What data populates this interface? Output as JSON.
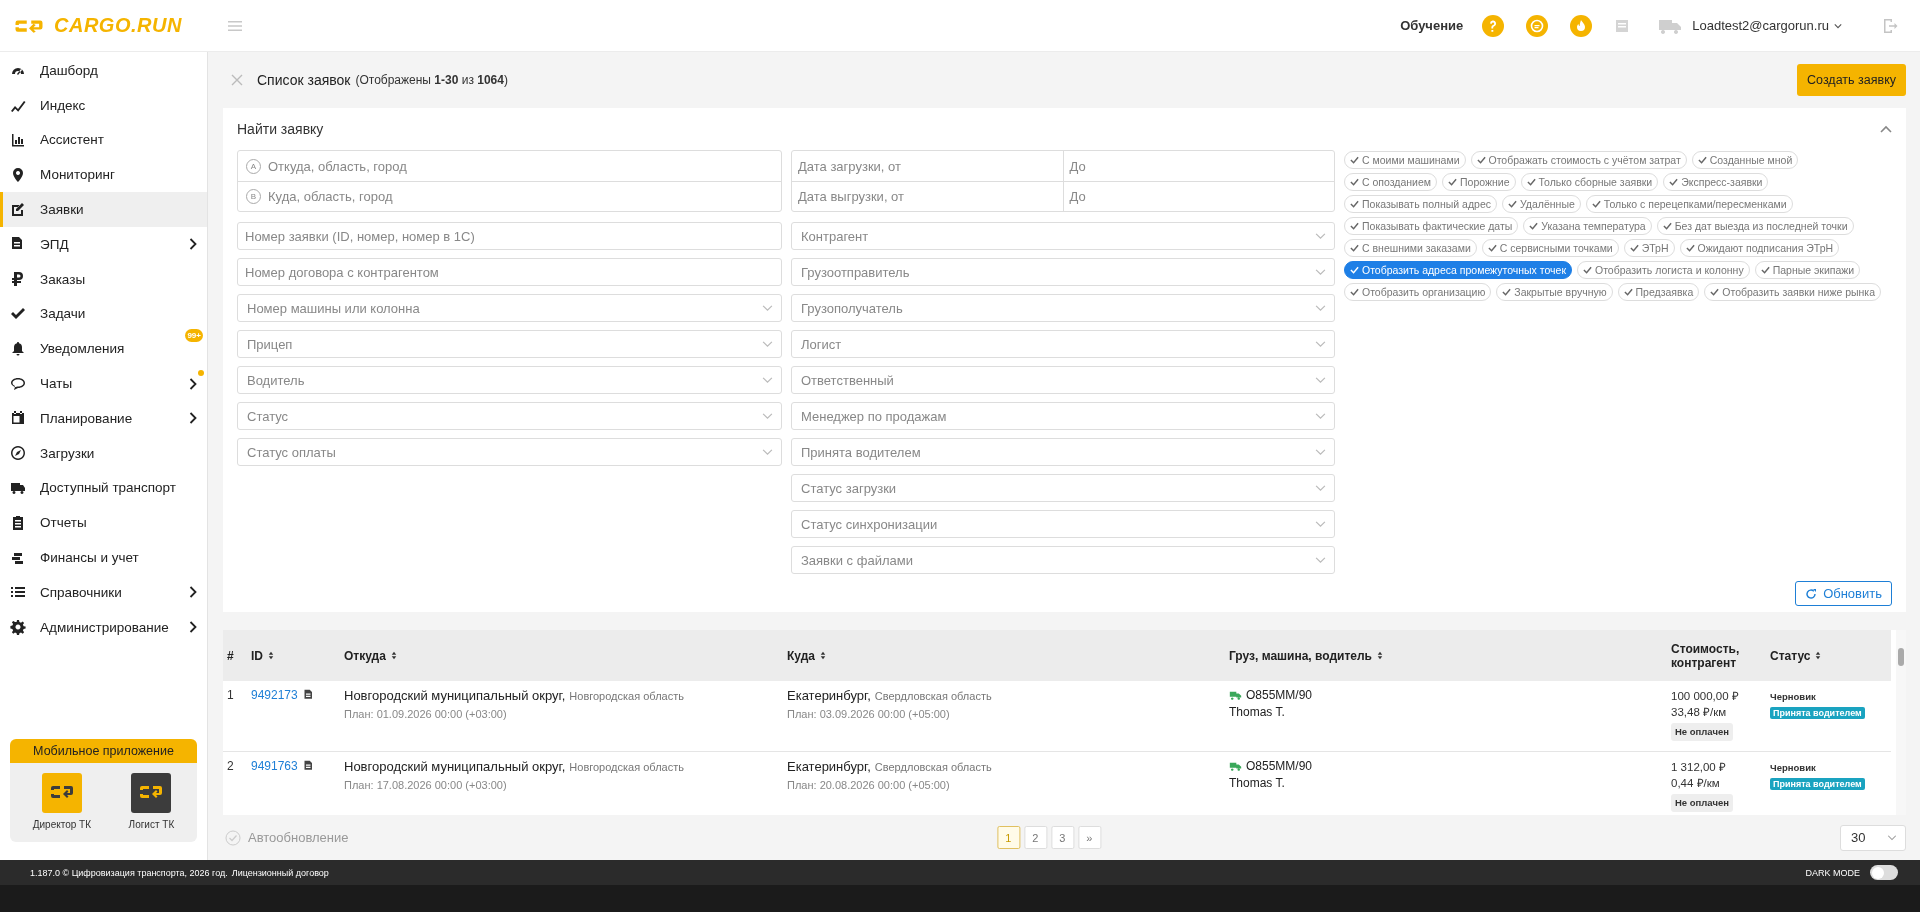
{
  "header": {
    "logo": "CARGO.RUN",
    "help_label": "Обучение",
    "user": "Loadtest2@cargorun.ru"
  },
  "sidebar": {
    "items": [
      {
        "label": "Дашборд",
        "selected": false,
        "expandable": false,
        "dot": false
      },
      {
        "label": "Индекс",
        "selected": false,
        "expandable": false,
        "dot": false
      },
      {
        "label": "Ассистент",
        "selected": false,
        "expandable": false,
        "dot": false
      },
      {
        "label": "Мониторинг",
        "selected": false,
        "expandable": false,
        "dot": false
      },
      {
        "label": "Заявки",
        "selected": true,
        "expandable": false,
        "dot": false
      },
      {
        "label": "ЭПД",
        "selected": false,
        "expandable": true,
        "dot": false
      },
      {
        "label": "Заказы",
        "selected": false,
        "expandable": false,
        "dot": false
      },
      {
        "label": "Задачи",
        "selected": false,
        "expandable": false,
        "dot": false
      },
      {
        "label": "Уведомления",
        "selected": false,
        "expandable": false,
        "dot": false,
        "badge": "99+"
      },
      {
        "label": "Чаты",
        "selected": false,
        "expandable": true,
        "dot": true
      },
      {
        "label": "Планирование",
        "selected": false,
        "expandable": true,
        "dot": false
      },
      {
        "label": "Загрузки",
        "selected": false,
        "expandable": false,
        "dot": false
      },
      {
        "label": "Доступный транспорт",
        "selected": false,
        "expandable": false,
        "dot": false
      },
      {
        "label": "Отчеты",
        "selected": false,
        "expandable": false,
        "dot": false
      },
      {
        "label": "Финансы и учет",
        "selected": false,
        "expandable": false,
        "dot": false
      },
      {
        "label": "Справочники",
        "selected": false,
        "expandable": true,
        "dot": false
      },
      {
        "label": "Администрирование",
        "selected": false,
        "expandable": true,
        "dot": false
      }
    ],
    "mobile_app": {
      "title": "Мобильное приложение",
      "apps": [
        {
          "label": "Директор ТК",
          "color": "#f5b400"
        },
        {
          "label": "Логист ТК",
          "color": "#3c3c3c"
        }
      ]
    }
  },
  "page": {
    "title": "Список заявок",
    "subtitle": "(Отображены **1-30** из **1064**)",
    "create_button": "Создать заявку"
  },
  "filters": {
    "title": "Найти заявку",
    "expanded": true,
    "route": [
      {
        "letter": "A",
        "placeholder": "Откуда, область, город"
      },
      {
        "letter": "B",
        "placeholder": "Куда, область, город"
      }
    ],
    "left": [
      {
        "placeholder": "Номер заявки (ID, номер, номер в 1С)",
        "kind": "text"
      },
      {
        "placeholder": "Номер договора с контрагентом",
        "kind": "text"
      },
      {
        "placeholder": "Номер машины или колонна",
        "kind": "select"
      },
      {
        "placeholder": "Прицеп",
        "kind": "select"
      },
      {
        "placeholder": "Водитель",
        "kind": "select"
      },
      {
        "placeholder": "Статус",
        "kind": "select"
      },
      {
        "placeholder": "Статус оплаты",
        "kind": "select"
      }
    ],
    "dates": [
      {
        "from": "Дата загрузки, от",
        "to": "До"
      },
      {
        "from": "Дата выгрузки, от",
        "to": "До"
      }
    ],
    "right": [
      {
        "placeholder": "Контрагент",
        "kind": "select"
      },
      {
        "placeholder": "Грузоотправитель",
        "kind": "select"
      },
      {
        "placeholder": "Грузополучатель",
        "kind": "select"
      },
      {
        "placeholder": "Логист",
        "kind": "select"
      },
      {
        "placeholder": "Ответственный",
        "kind": "select"
      },
      {
        "placeholder": "Менеджер по продажам",
        "kind": "select"
      },
      {
        "placeholder": "Принята водителем",
        "kind": "select"
      },
      {
        "placeholder": "Статус загрузки",
        "kind": "select"
      },
      {
        "placeholder": "Статус синхронизации",
        "kind": "select"
      },
      {
        "placeholder": "Заявки с файлами",
        "kind": "select"
      }
    ],
    "tags": [
      {
        "label": "С моими машинами",
        "selected": false
      },
      {
        "label": "Отображать стоимость с учётом затрат",
        "selected": false
      },
      {
        "label": "Созданные мной",
        "selected": false
      },
      {
        "label": "С опозданием",
        "selected": false
      },
      {
        "label": "Порожние",
        "selected": false
      },
      {
        "label": "Только сборные заявки",
        "selected": false
      },
      {
        "label": "Экспресс-заявки",
        "selected": false
      },
      {
        "label": "Показывать полный адрес",
        "selected": false
      },
      {
        "label": "Удалённые",
        "selected": false
      },
      {
        "label": "Только с перецепками/пересменками",
        "selected": false
      },
      {
        "label": "Показывать фактические даты",
        "selected": false
      },
      {
        "label": "Указана температура",
        "selected": false
      },
      {
        "label": "Без дат выезда из последней точки",
        "selected": false
      },
      {
        "label": "С внешними заказами",
        "selected": false
      },
      {
        "label": "С сервисными точками",
        "selected": false
      },
      {
        "label": "ЭТрН",
        "selected": false
      },
      {
        "label": "Ожидают подписания ЭТрН",
        "selected": false
      },
      {
        "label": "Отобразить адреса промежуточных точек",
        "selected": true
      },
      {
        "label": "Отобразить логиста и колонну",
        "selected": false
      },
      {
        "label": "Парные экипажи",
        "selected": false
      },
      {
        "label": "Отобразить организацию",
        "selected": false
      },
      {
        "label": "Закрытые вручную",
        "selected": false
      },
      {
        "label": "Предзаявка",
        "selected": false
      },
      {
        "label": "Отобразить заявки ниже рынка",
        "selected": false
      }
    ],
    "refresh_button": "Обновить"
  },
  "table": {
    "columns": [
      {
        "label": "#",
        "sortable": false
      },
      {
        "label": "ID",
        "sortable": true
      },
      {
        "label": "Откуда",
        "sortable": true
      },
      {
        "label": "Куда",
        "sortable": true
      },
      {
        "label": "Груз, машина, водитель",
        "sortable": true
      },
      {
        "label": "Стоимость, контрагент",
        "sortable": false
      },
      {
        "label": "Статус",
        "sortable": true
      }
    ],
    "rows": [
      {
        "num": "1",
        "id": "9492173",
        "from_city": "Новгородский муниципальный округ,",
        "from_region": "Новгородская область",
        "from_plan": "План: 01.09.2026 00:00 (+03:00)",
        "to_city": "Екатеринбург,",
        "to_region": "Свердловская область",
        "to_plan": "План: 03.09.2026 00:00 (+05:00)",
        "vehicle": "О855ММ/90",
        "driver": "Thomas T.",
        "price": "100 000,00 ₽",
        "rate": "33,48 ₽/км",
        "payment": "Не оплачен",
        "status": "Черновик",
        "accepted": "Принята водителем"
      },
      {
        "num": "2",
        "id": "9491763",
        "from_city": "Новгородский муниципальный округ,",
        "from_region": "Новгородская область",
        "from_plan": "План: 17.08.2026 00:00 (+03:00)",
        "to_city": "Екатеринбург,",
        "to_region": "Свердловская область",
        "to_plan": "План: 20.08.2026 00:00 (+05:00)",
        "vehicle": "О855ММ/90",
        "driver": "Thomas T.",
        "price": "1 312,00 ₽",
        "rate": "0,44 ₽/км",
        "payment": "Не оплачен",
        "status": "Черновик",
        "accepted": "Принята водителем"
      }
    ]
  },
  "bottom": {
    "autoupdate": {
      "label": "Автообновление",
      "checked": false
    },
    "pagination": {
      "pages": [
        {
          "label": "1",
          "selected": true
        },
        {
          "label": "2",
          "selected": false
        },
        {
          "label": "3",
          "selected": false
        }
      ],
      "next": "»"
    },
    "page_size": "30"
  },
  "footer": {
    "version": "1.187.0 © Цифровизация транспорта, 2026 год.",
    "license_link": "Лицензионный договор",
    "dark_mode": {
      "label": "DARK MODE",
      "on": false
    }
  }
}
